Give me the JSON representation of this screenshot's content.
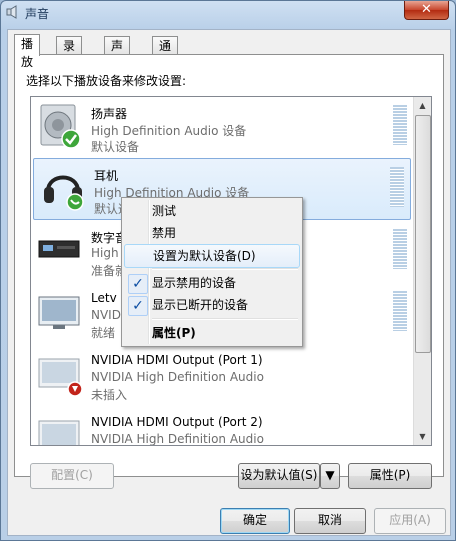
{
  "window": {
    "title": "声音"
  },
  "tabs": [
    {
      "label": "播放",
      "active": true
    },
    {
      "label": "录制",
      "active": false
    },
    {
      "label": "声音",
      "active": false
    },
    {
      "label": "通信",
      "active": false
    }
  ],
  "instruction": "选择以下播放设备来修改设置:",
  "devices": [
    {
      "name": "扬声器",
      "sub": "High Definition Audio 设备",
      "status": "默认设备",
      "icon": "speaker-icon",
      "badge": "default-check"
    },
    {
      "name": "耳机",
      "sub": "High Definition Audio 设备",
      "status": "默认通",
      "icon": "headphones-icon",
      "badge": "communication-phone"
    },
    {
      "name": "数字音",
      "sub": "High",
      "status": "准备就",
      "icon": "digital-output-icon"
    },
    {
      "name": "Letv",
      "sub": "NVID",
      "status": "就绪",
      "icon": "monitor-icon"
    },
    {
      "name": "NVIDIA HDMI Output (Port 1)",
      "sub": "NVIDIA High Definition Audio",
      "status": "未插入",
      "icon": "monitor-unplugged-icon",
      "badge": "unplugged-arrow"
    },
    {
      "name": "NVIDIA HDMI Output (Port 2)",
      "sub": "NVIDIA High Definition Audio",
      "status": "",
      "icon": "monitor-icon"
    }
  ],
  "context_menu": {
    "items": [
      {
        "label": "测试"
      },
      {
        "label": "禁用"
      },
      {
        "label": "设置为默认设备(D)"
      },
      {
        "label": "显示禁用的设备",
        "checked": true
      },
      {
        "label": "显示已断开的设备",
        "checked": true
      },
      {
        "label": "属性(P)",
        "bold": true
      }
    ]
  },
  "buttons": {
    "configure": "配置(C)",
    "set_default": "设为默认值(S)",
    "properties": "属性(P)",
    "ok": "确定",
    "cancel": "取消",
    "apply": "应用(A)"
  },
  "colors": {
    "accent": "#0c4da2",
    "selection": "#d9ebfb"
  }
}
